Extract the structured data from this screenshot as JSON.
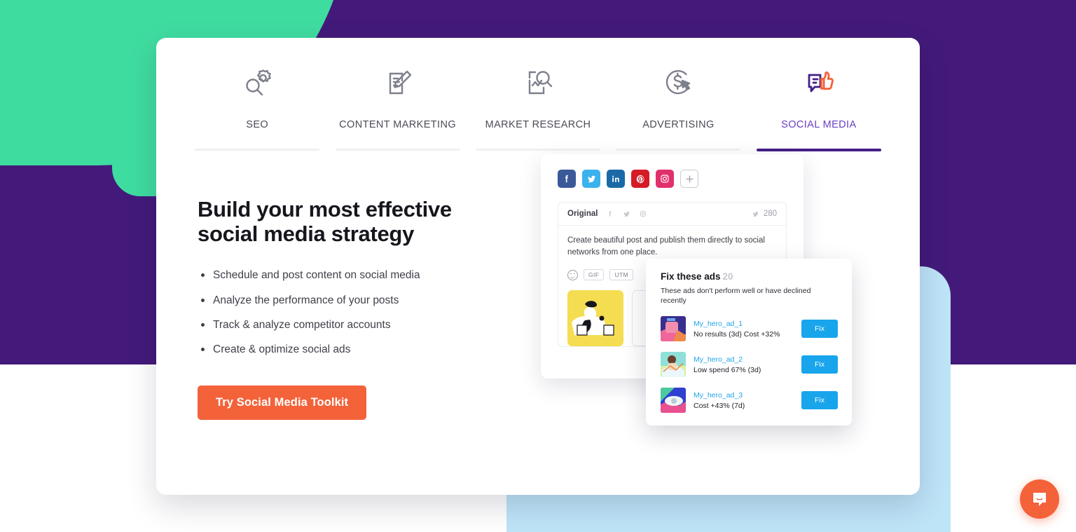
{
  "colors": {
    "purple_bg": "#431a7a",
    "green_bubble": "#3fdca0",
    "blue_panel": "#bee4f8",
    "accent_orange": "#f4623a",
    "active_tab_purple": "#6c3fc4",
    "link_blue": "#22a5e8",
    "fix_button_blue": "#19a5ec"
  },
  "tabs": [
    {
      "label": "SEO",
      "icon": "seo-magnifier-gear-icon",
      "active": false
    },
    {
      "label": "CONTENT MARKETING",
      "icon": "document-pencil-icon",
      "active": false
    },
    {
      "label": "MARKET RESEARCH",
      "icon": "report-magnifier-icon",
      "active": false
    },
    {
      "label": "ADVERTISING",
      "icon": "dollar-cursor-icon",
      "active": false
    },
    {
      "label": "SOCIAL MEDIA",
      "icon": "speech-bubble-thumbsup-icon",
      "active": true
    }
  ],
  "hero": {
    "headline_line1": "Build your most effective",
    "headline_line2": "social media strategy",
    "bullets": [
      "Schedule and post content on social media",
      "Analyze the performance of your posts",
      "Track & analyze competitor accounts",
      "Create & optimize social ads"
    ],
    "cta_label": "Try Social Media Toolkit"
  },
  "composer": {
    "networks": [
      {
        "name": "facebook",
        "color": "#3b5998"
      },
      {
        "name": "twitter",
        "color": "#3bb2ec"
      },
      {
        "name": "linkedin",
        "color": "#1a6aa7"
      },
      {
        "name": "pinterest",
        "color": "#d51b26"
      },
      {
        "name": "instagram",
        "color": "#e1306c"
      }
    ],
    "add_label": "+",
    "tab_original": "Original",
    "char_count": "280",
    "post_text": "Create beautiful post and publish them directly to social networks from one place.",
    "tools": [
      "GIF",
      "UTM"
    ]
  },
  "fix_ads": {
    "title": "Fix these ads",
    "count": "20",
    "subtitle": "These ads don't perform well or have declined recently",
    "action_label": "Fix",
    "rows": [
      {
        "name": "My_hero_ad_1",
        "stat": "No results (3d)  Cost +32%",
        "thumb_a": "#3a2f8f",
        "thumb_b": "#f0669a"
      },
      {
        "name": "My_hero_ad_2",
        "stat": "Low spend 67% (3d)",
        "thumb_a": "#8fe0d8",
        "thumb_b": "#d7f0a0"
      },
      {
        "name": "My_hero_ad_3",
        "stat": "Cost +43% (7d)",
        "thumb_a": "#4cc9a0",
        "thumb_b": "#2f3fd0"
      }
    ]
  },
  "chat": {
    "icon": "chat-bubble-icon",
    "label": "Open chat"
  }
}
